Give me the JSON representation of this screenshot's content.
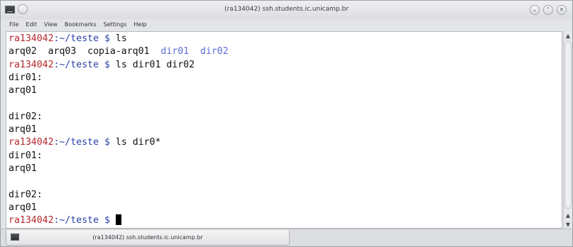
{
  "window": {
    "title": "(ra134042) ssh.students.ic.unicamp.br",
    "controls": [
      "minimize",
      "maximize",
      "close"
    ]
  },
  "menu": [
    "File",
    "Edit",
    "View",
    "Bookmarks",
    "Settings",
    "Help"
  ],
  "terminal": {
    "prompt_user": "ra134042",
    "prompt_path": ":~/teste $ ",
    "lines": [
      {
        "type": "cmd",
        "text": "ls"
      },
      {
        "type": "ls",
        "files": [
          "arq02",
          "arq03",
          "copia-arq01"
        ],
        "dirs": [
          "dir01",
          "dir02"
        ]
      },
      {
        "type": "cmd",
        "text": "ls dir01 dir02"
      },
      {
        "type": "out",
        "text": "dir01:"
      },
      {
        "type": "out",
        "text": "arq01"
      },
      {
        "type": "out",
        "text": ""
      },
      {
        "type": "out",
        "text": "dir02:"
      },
      {
        "type": "out",
        "text": "arq01"
      },
      {
        "type": "cmd",
        "text": "ls dir0*"
      },
      {
        "type": "out",
        "text": "dir01:"
      },
      {
        "type": "out",
        "text": "arq01"
      },
      {
        "type": "out",
        "text": ""
      },
      {
        "type": "out",
        "text": "dir02:"
      },
      {
        "type": "out",
        "text": "arq01"
      },
      {
        "type": "cmd",
        "text": "",
        "cursor": true
      }
    ]
  },
  "tab": {
    "label": "(ra134042) ssh.students.ic.unicamp.br"
  },
  "colors": {
    "prompt_user": "#b3272b",
    "prompt_path": "#2a43a8",
    "directory": "#5b6ad8"
  },
  "icons": {
    "app": "terminal-icon",
    "pin": "sticky-icon",
    "minimize": "chevron-down-icon",
    "maximize": "chevron-up-icon",
    "close": "close-icon",
    "scroll_up": "arrow-up-icon",
    "scroll_down": "arrow-down-icon"
  }
}
